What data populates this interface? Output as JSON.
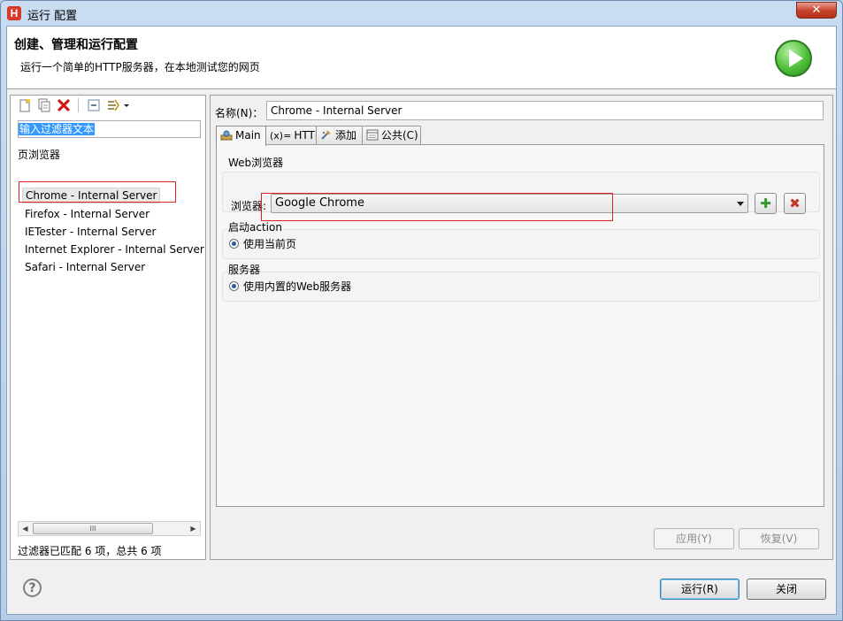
{
  "window": {
    "title": "运行 配置",
    "app_icon": "H",
    "close_glyph": "✕"
  },
  "header": {
    "title": "创建、管理和运行配置",
    "subtitle": "运行一个简单的HTTP服务器，在本地测试您的网页"
  },
  "sidebar": {
    "toolbar": [
      "new-config-icon",
      "duplicate-icon",
      "delete-icon",
      "collapse-all-icon",
      "filter-icon",
      "dropdown-arrow-icon"
    ],
    "filter_placeholder": "输入过滤器文本",
    "category": "页浏览器",
    "items": [
      {
        "label": "Chrome - Internal Server",
        "selected": true
      },
      {
        "label": "Firefox - Internal Server"
      },
      {
        "label": "IETester - Internal Server"
      },
      {
        "label": "Internet Explorer - Internal Server"
      },
      {
        "label": "Safari - Internal Server"
      }
    ],
    "scroll_left": "◀",
    "scroll_right": "▶",
    "scroll_thumb": "III",
    "status": "过滤器已匹配 6 项，总共 6 项"
  },
  "main": {
    "name_label": "名称(N)：",
    "name_value": "Chrome - Internal Server",
    "tabs": [
      {
        "label": "Main",
        "icon": "main-tab-icon",
        "active": true
      },
      {
        "label": "HTTP",
        "icon": "http-tab-icon"
      },
      {
        "label": "添加",
        "icon": "add-tab-icon"
      },
      {
        "label": "公共(C)",
        "icon": "common-tab-icon"
      }
    ],
    "web_browser_group": "Web浏览器",
    "browser_label": "浏览器:",
    "browser_value": "Google Chrome",
    "add_browser_glyph": "✚",
    "config_browser_glyph": "✖",
    "launch_group": "启动action",
    "launch_option": "使用当前页",
    "server_group": "服务器",
    "server_option": "使用内置的Web服务器",
    "apply_button": "应用(Y)",
    "revert_button": "恢复(V)"
  },
  "footer": {
    "help_glyph": "?",
    "run_button": "运行(R)",
    "close_button": "关闭"
  },
  "colors": {
    "highlight_box": "#e02222",
    "selection": "#3399ff",
    "run_icon": "#4fbf3b",
    "delete_icon": "#d01a1a"
  }
}
